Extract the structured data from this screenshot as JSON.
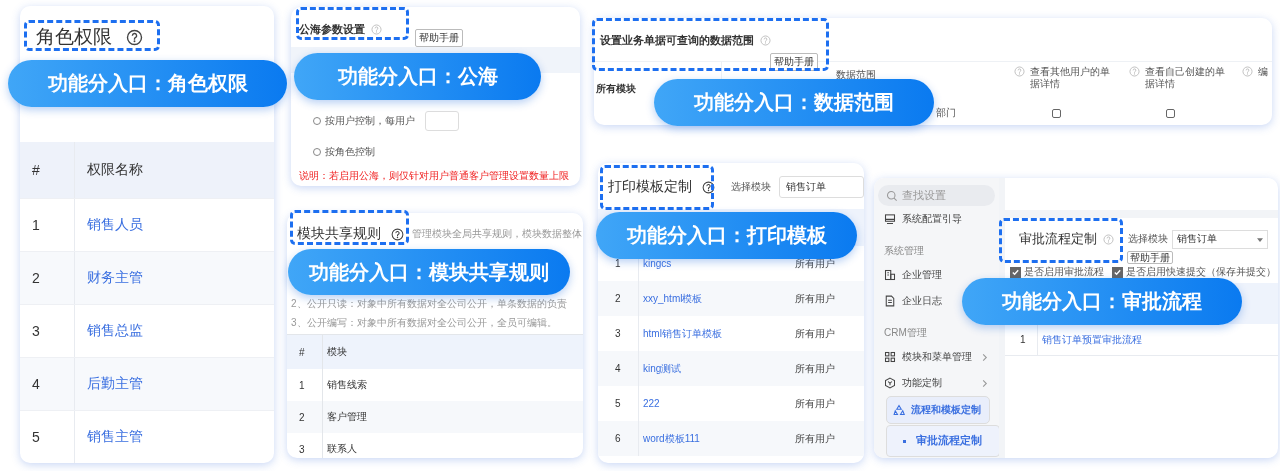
{
  "role_permissions": {
    "title": "角色权限",
    "callout": "功能分入口：角色权限",
    "columns": [
      "#",
      "权限名称"
    ],
    "rows": [
      [
        "1",
        "销售人员"
      ],
      [
        "2",
        "财务主管"
      ],
      [
        "3",
        "销售总监"
      ],
      [
        "4",
        "后勤主管"
      ],
      [
        "5",
        "销售主管"
      ]
    ]
  },
  "public_sea": {
    "title": "公海参数设置",
    "help": "帮助手册",
    "callout": "功能分入口：公海",
    "options": [
      {
        "label": "按用户控制，每用户",
        "selected": false,
        "kind": "input"
      },
      {
        "label": "按角色控制",
        "selected": false,
        "kind": "plain"
      }
    ],
    "note": "说明：若启用公海，则仅针对用户普通客户管理设置数量上限"
  },
  "module_sharing": {
    "title": "模块共享规则",
    "description": "管理模块全局共享规则，模块数据整体",
    "callout": "功能分入口：模块共享规则",
    "rules": [
      "2、公开只读：对象中所有数据对全公司公开，单条数据的负责",
      "3、公开编写：对象中所有数据对全公司公开，全员可编辑。"
    ],
    "columns": [
      "#",
      "模块"
    ],
    "rows": [
      [
        "1",
        "销售线索"
      ],
      [
        "2",
        "客户管理"
      ],
      [
        "3",
        "联系人"
      ]
    ]
  },
  "data_scope": {
    "title": "设置业务单据可查询的数据范围",
    "help": "帮助手册",
    "callout": "功能分入口：数据范围",
    "columns": [
      "数据范围",
      "查看其他用户的单据详情",
      "查看自己创建的单据详情",
      "编"
    ],
    "rows": [
      {
        "module": "所有模块",
        "scope": "部门",
        "checks": [
          false,
          false
        ]
      }
    ]
  },
  "print_templates": {
    "title": "打印模板定制",
    "module_label": "选择模块",
    "module": "销售订单",
    "callout": "功能分入口：打印模板",
    "rows": [
      [
        "1",
        "kingcs",
        "所有用户"
      ],
      [
        "2",
        "xxy_html模板",
        "所有用户"
      ],
      [
        "3",
        "html销售订单模板",
        "所有用户"
      ],
      [
        "4",
        "king测试",
        "所有用户"
      ],
      [
        "5",
        "222",
        "所有用户"
      ],
      [
        "6",
        "word模板111",
        "所有用户"
      ]
    ]
  },
  "approval_flow": {
    "search_placeholder": "查找设置",
    "sidebar": [
      {
        "kind": "item",
        "label": "系统配置引导"
      },
      {
        "kind": "section",
        "label": "系统管理"
      },
      {
        "kind": "item",
        "label": "企业管理"
      },
      {
        "kind": "item",
        "label": "企业日志"
      },
      {
        "kind": "section",
        "label": "CRM管理"
      },
      {
        "kind": "group",
        "label": "模块和菜单管理",
        "expanded": false,
        "selected": false
      },
      {
        "kind": "group",
        "label": "功能定制",
        "expanded": false,
        "selected": false
      },
      {
        "kind": "group",
        "label": "流程和模板定制",
        "expanded": true,
        "selected": true,
        "children": [
          {
            "label": "审批流程定制",
            "selected": true
          }
        ]
      }
    ],
    "title": "审批流程定制",
    "module_label": "选择模块",
    "module": "销售订单",
    "help": "帮助手册",
    "options": [
      {
        "label": "是否启用审批流程",
        "checked": true
      },
      {
        "label": "是否启用快速提交（保存并提交）",
        "checked": true
      }
    ],
    "callout": "功能分入口：审批流程",
    "rows": [
      [
        "1",
        "销售订单预置审批流程"
      ]
    ]
  }
}
